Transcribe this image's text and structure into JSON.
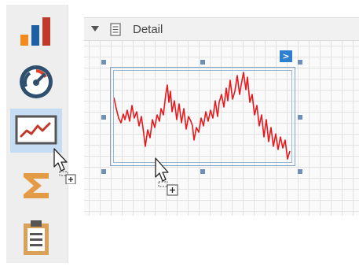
{
  "band": {
    "title": "Detail"
  },
  "toolbox": {
    "items": [
      {
        "icon": "bar-chart-icon",
        "selected": false
      },
      {
        "icon": "gauge-icon",
        "selected": false
      },
      {
        "icon": "sparkline-icon",
        "selected": true
      },
      {
        "icon": "summary-sigma-icon",
        "selected": false
      },
      {
        "icon": "clipboard-icon",
        "selected": false
      }
    ]
  },
  "smart_tag": {
    "glyph": ">"
  },
  "colors": {
    "selection": "#c5dcf2",
    "chart_line": "#e8191c",
    "smart_tag": "#2e7fd0",
    "handle": "#6e90b6",
    "bar_orange": "#f28a1e",
    "bar_red": "#c0392b"
  }
}
